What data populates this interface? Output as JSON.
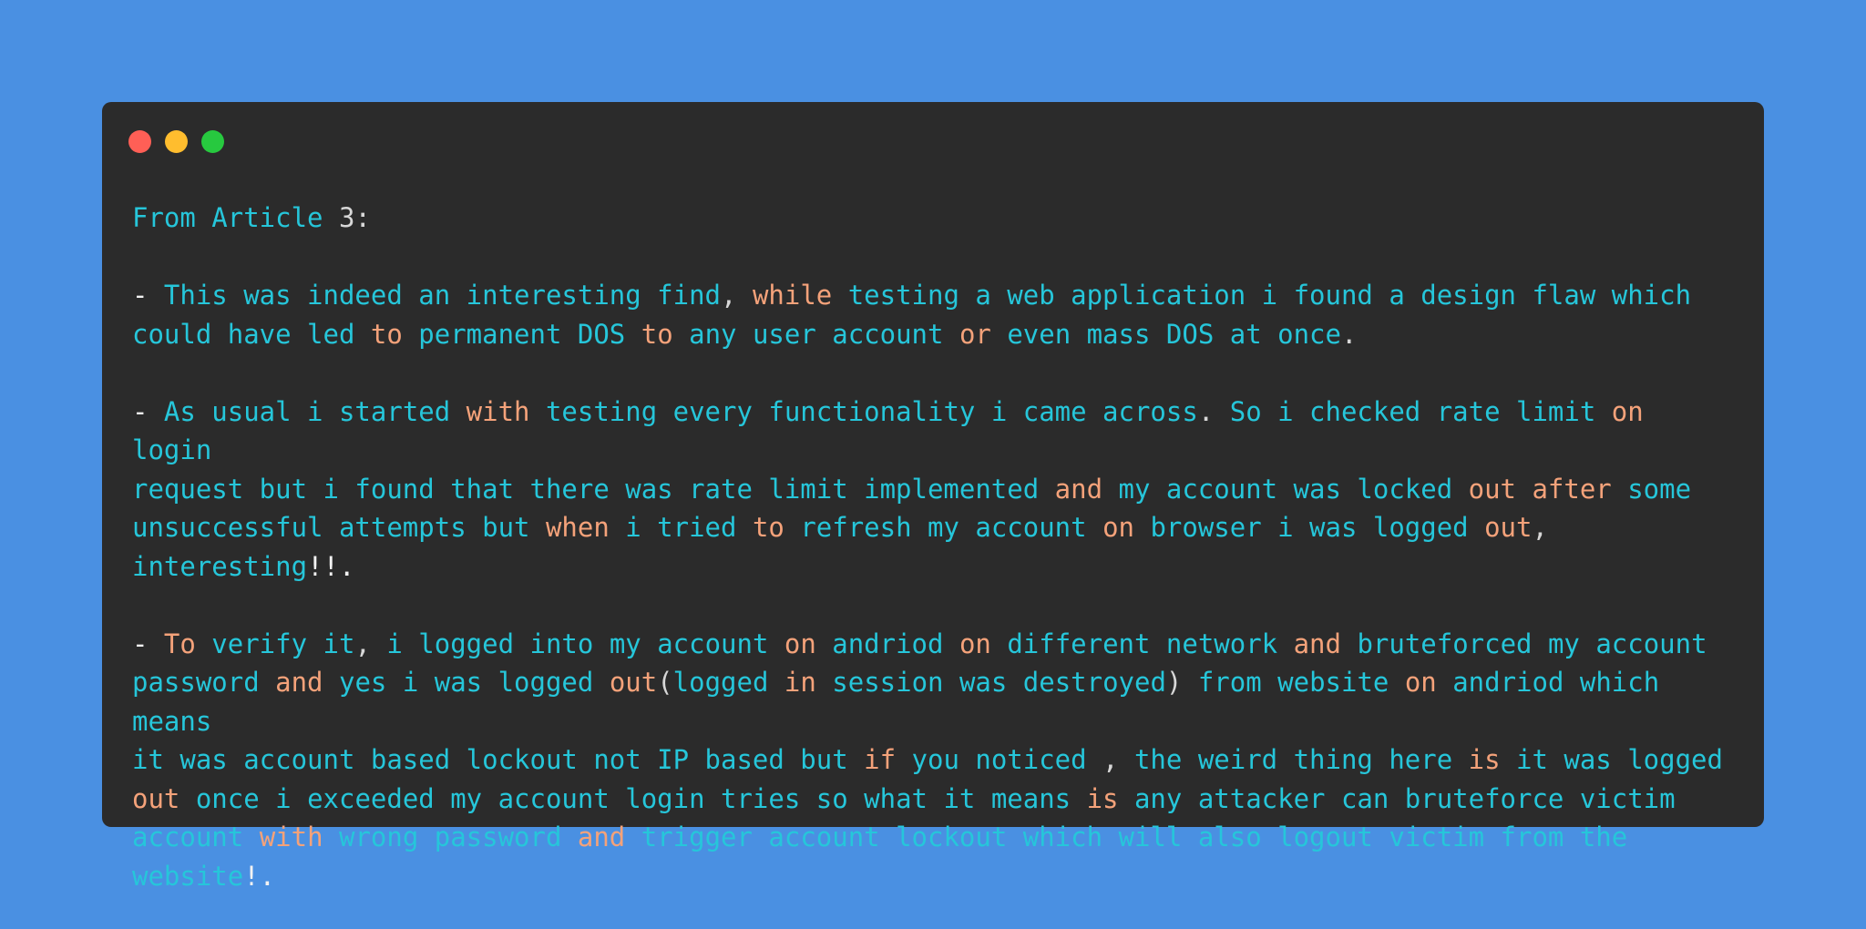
{
  "window": {
    "controls": [
      {
        "name": "close",
        "color": "#ff5f56"
      },
      {
        "name": "minimize",
        "color": "#ffbd2e"
      },
      {
        "name": "zoom",
        "color": "#27c93f"
      }
    ]
  },
  "colors": {
    "background": "#4a90e2",
    "panel": "#2b2b2b",
    "cyan": "#26c6da",
    "orange": "#f4a27a",
    "white": "#f2f2f2"
  },
  "lines": [
    [
      [
        "c",
        "From Article "
      ],
      [
        "d",
        "3:"
      ]
    ],
    [],
    [
      [
        "w",
        "- "
      ],
      [
        "c",
        "This was indeed an interesting find"
      ],
      [
        "d",
        ", "
      ],
      [
        "o",
        "while"
      ],
      [
        "c",
        " testing a web application i found a design flaw which"
      ]
    ],
    [
      [
        "c",
        "could have led "
      ],
      [
        "o",
        "to"
      ],
      [
        "c",
        " permanent DOS "
      ],
      [
        "o",
        "to"
      ],
      [
        "c",
        " any user account "
      ],
      [
        "o",
        "or"
      ],
      [
        "c",
        " even mass DOS at once"
      ],
      [
        "d",
        "."
      ]
    ],
    [],
    [
      [
        "w",
        "- "
      ],
      [
        "c",
        "As usual i started "
      ],
      [
        "o",
        "with"
      ],
      [
        "c",
        " testing every functionality i came across"
      ],
      [
        "d",
        "."
      ],
      [
        "c",
        " So i checked rate limit "
      ],
      [
        "o",
        "on"
      ],
      [
        "c",
        " login"
      ]
    ],
    [
      [
        "c",
        "request but i found that there was rate limit implemented "
      ],
      [
        "o",
        "and"
      ],
      [
        "c",
        " my account was locked "
      ],
      [
        "o",
        "out after"
      ],
      [
        "c",
        " some"
      ]
    ],
    [
      [
        "c",
        "unsuccessful attempts but "
      ],
      [
        "o",
        "when"
      ],
      [
        "c",
        " i tried "
      ],
      [
        "o",
        "to"
      ],
      [
        "c",
        " refresh my account "
      ],
      [
        "o",
        "on"
      ],
      [
        "c",
        " browser i was logged "
      ],
      [
        "o",
        "out"
      ],
      [
        "d",
        ","
      ]
    ],
    [
      [
        "c",
        "interesting"
      ],
      [
        "w",
        "!!."
      ]
    ],
    [],
    [
      [
        "w",
        "- "
      ],
      [
        "o",
        "To"
      ],
      [
        "c",
        " verify it"
      ],
      [
        "d",
        ","
      ],
      [
        "c",
        " i logged into my account "
      ],
      [
        "o",
        "on"
      ],
      [
        "c",
        " andriod "
      ],
      [
        "o",
        "on"
      ],
      [
        "c",
        " different network "
      ],
      [
        "o",
        "and"
      ],
      [
        "c",
        " bruteforced my account"
      ]
    ],
    [
      [
        "c",
        "password "
      ],
      [
        "o",
        "and"
      ],
      [
        "c",
        " yes i was logged "
      ],
      [
        "o",
        "out"
      ],
      [
        "d",
        "("
      ],
      [
        "c",
        "logged "
      ],
      [
        "o",
        "in"
      ],
      [
        "c",
        " session was destroyed"
      ],
      [
        "d",
        ")"
      ],
      [
        "c",
        " from website "
      ],
      [
        "o",
        "on"
      ],
      [
        "c",
        " andriod which means"
      ]
    ],
    [
      [
        "c",
        "it was account based lockout not IP based but "
      ],
      [
        "o",
        "if"
      ],
      [
        "c",
        " you noticed "
      ],
      [
        "d",
        ","
      ],
      [
        "c",
        " the weird thing here "
      ],
      [
        "o",
        "is"
      ],
      [
        "c",
        " it was logged"
      ]
    ],
    [
      [
        "o",
        "out"
      ],
      [
        "c",
        " once i exceeded my account login tries so what it means "
      ],
      [
        "o",
        "is"
      ],
      [
        "c",
        " any attacker can bruteforce victim"
      ]
    ],
    [
      [
        "c",
        "account "
      ],
      [
        "o",
        "with"
      ],
      [
        "c",
        " wrong password "
      ],
      [
        "o",
        "and"
      ],
      [
        "c",
        " trigger account lockout which will also logout victim from the"
      ]
    ],
    [
      [
        "c",
        "website"
      ],
      [
        "w",
        "!."
      ]
    ]
  ]
}
